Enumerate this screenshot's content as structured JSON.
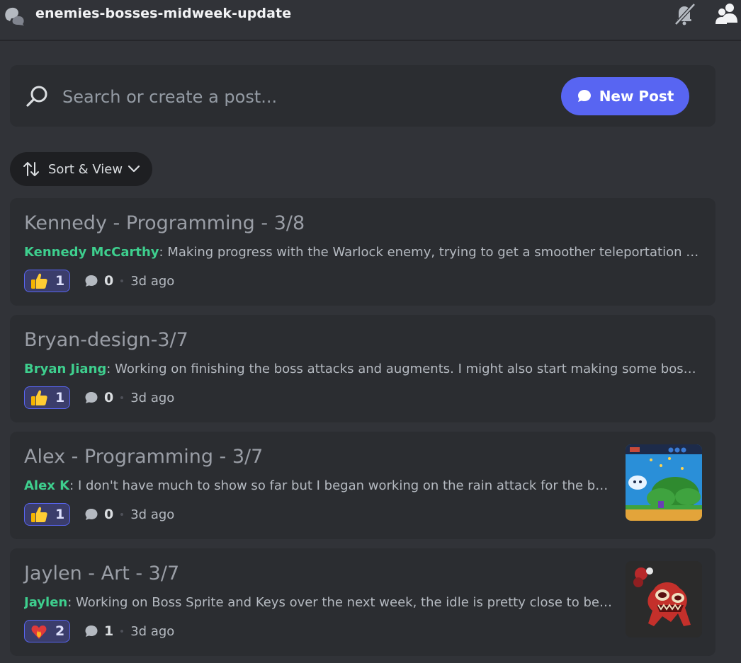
{
  "header": {
    "channel_name": "enemies-bosses-midweek-update",
    "icons": [
      "forum-icon",
      "notifications-muted-icon",
      "members-icon"
    ]
  },
  "search": {
    "placeholder": "Search or create a post...",
    "value": "",
    "new_post_label": "New Post"
  },
  "sort": {
    "label": "Sort & View"
  },
  "colors": {
    "background": "#313338",
    "card": "#2b2d31",
    "accent": "#5865f2",
    "author": "#3ecf8e"
  },
  "posts": [
    {
      "title": "Kennedy - Programming - 3/8",
      "author": "Kennedy McCarthy",
      "preview": " Making progress with the Warlock enemy, trying to get a smoother teleportation system",
      "reaction_emoji": "thumbs-up",
      "reaction_count": "1",
      "comment_count": "0",
      "timestamp": "3d ago",
      "thumbnail": null
    },
    {
      "title": "Bryan-design-3/7",
      "author": "Bryan Jiang",
      "preview": " Working on finishing the boss attacks and augments. I might also start making some boss rooms",
      "reaction_emoji": "thumbs-up",
      "reaction_count": "1",
      "comment_count": "0",
      "timestamp": "3d ago",
      "thumbnail": null
    },
    {
      "title": "Alex - Programming - 3/7",
      "author": "Alex K",
      "preview": " I don't have much to show so far but I began working on the rain attack for the boss...",
      "reaction_emoji": "thumbs-up",
      "reaction_count": "1",
      "comment_count": "0",
      "timestamp": "3d ago",
      "thumbnail": "game-screenshot"
    },
    {
      "title": "Jaylen - Art - 3/7",
      "author": "Jaylen",
      "preview": " Working on Boss Sprite and Keys over the next week, the idle is pretty close to bein...",
      "reaction_emoji": "fire-heart",
      "reaction_count": "2",
      "comment_count": "1",
      "timestamp": "3d ago",
      "thumbnail": "boss-sprite"
    }
  ]
}
